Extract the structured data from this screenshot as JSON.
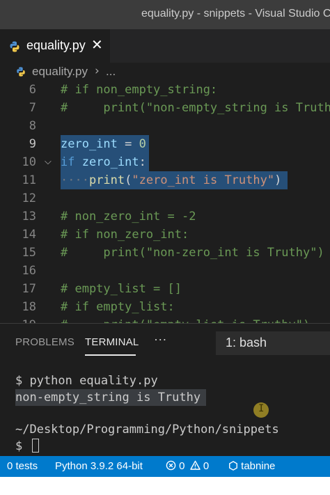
{
  "window": {
    "title": "equality.py - snippets - Visual Studio Code"
  },
  "tab": {
    "filename": "equality.py",
    "close": "✕"
  },
  "breadcrumb": {
    "file": "equality.py",
    "separator": "›",
    "more": "..."
  },
  "editor": {
    "active_line": "9",
    "selection_color": "#264f78",
    "lines": [
      {
        "number": "6",
        "text": "# if non_empty_string:"
      },
      {
        "number": "7",
        "text": "#     print(\"non-empty_string is Truthy\")"
      },
      {
        "number": "8",
        "text": ""
      },
      {
        "number": "9",
        "text": "zero_int = 0"
      },
      {
        "number": "10",
        "text": "if zero_int:"
      },
      {
        "number": "11",
        "text": "    print(\"zero_int is Truthy\")"
      },
      {
        "number": "12",
        "text": ""
      },
      {
        "number": "13",
        "text": "# non_zero_int = -2"
      },
      {
        "number": "14",
        "text": "# if non_zero_int:"
      },
      {
        "number": "15",
        "text": "#     print(\"non-zero_int is Truthy\")"
      },
      {
        "number": "16",
        "text": ""
      },
      {
        "number": "17",
        "text": "# empty_list = []"
      },
      {
        "number": "18",
        "text": "# if empty_list:"
      },
      {
        "number": "19",
        "text": "#     print(\"empty_list is Truthy\")"
      }
    ]
  },
  "panel": {
    "tabs": {
      "problems": "PROBLEMS",
      "terminal": "TERMINAL",
      "more": "···"
    },
    "terminal_selector": "1: bash",
    "terminal_lines": [
      "$ python equality.py",
      "non-empty_string is Truthy",
      "",
      "~/Desktop/Programming/Python/snippets",
      "$ "
    ]
  },
  "statusbar": {
    "tests": "0 tests",
    "python": "Python 3.9.2 64-bit",
    "errors": "0",
    "warnings": "0",
    "tabnine": "tabnine",
    "color": "#007acc"
  }
}
